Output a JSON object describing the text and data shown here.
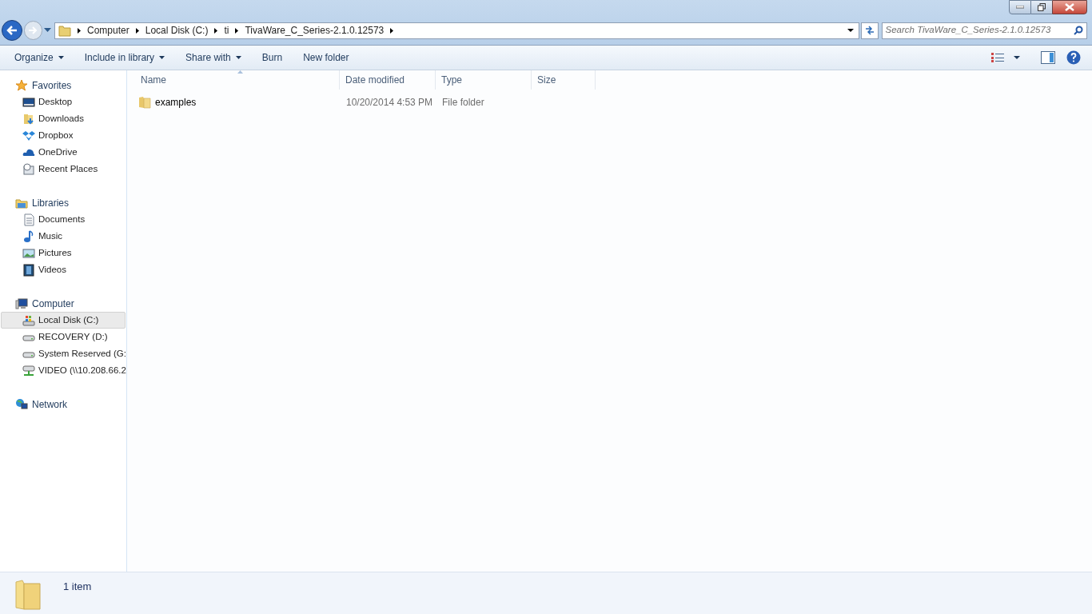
{
  "address_bar": {
    "crumbs": [
      "Computer",
      "Local Disk (C:)",
      "ti",
      "TivaWare_C_Series-2.1.0.12573"
    ]
  },
  "search": {
    "placeholder": "Search TivaWare_C_Series-2.1.0.12573"
  },
  "toolbar": [
    {
      "label": "Organize",
      "has_menu": true
    },
    {
      "label": "Include in library",
      "has_menu": true
    },
    {
      "label": "Share with",
      "has_menu": true
    },
    {
      "label": "Burn",
      "has_menu": false
    },
    {
      "label": "New folder",
      "has_menu": false
    }
  ],
  "sidebar": {
    "groups": [
      {
        "label": "Favorites",
        "kind": "star",
        "items": [
          {
            "label": "Desktop",
            "kind": "desktop",
            "selected": false
          },
          {
            "label": "Downloads",
            "kind": "downloads",
            "selected": false
          },
          {
            "label": "Dropbox",
            "kind": "dropbox",
            "selected": false
          },
          {
            "label": "OneDrive",
            "kind": "cloud",
            "selected": false
          },
          {
            "label": "Recent Places",
            "kind": "recent",
            "selected": false
          }
        ]
      },
      {
        "label": "Libraries",
        "kind": "library",
        "items": [
          {
            "label": "Documents",
            "kind": "document",
            "selected": false
          },
          {
            "label": "Music",
            "kind": "music",
            "selected": false
          },
          {
            "label": "Pictures",
            "kind": "picture",
            "selected": false
          },
          {
            "label": "Videos",
            "kind": "video",
            "selected": false
          }
        ]
      },
      {
        "label": "Computer",
        "kind": "computer",
        "items": [
          {
            "label": "Local Disk (C:)",
            "kind": "sysdrive",
            "selected": true
          },
          {
            "label": "RECOVERY (D:)",
            "kind": "drive",
            "selected": false
          },
          {
            "label": "System Reserved (G:",
            "kind": "drive",
            "selected": false
          },
          {
            "label": "VIDEO (\\\\10.208.66.2",
            "kind": "netdrive",
            "selected": false
          }
        ]
      },
      {
        "label": "Network",
        "kind": "network"
      }
    ]
  },
  "table": {
    "columns": [
      {
        "label": "Name",
        "sorted": true
      },
      {
        "label": "Date modified",
        "sorted": false
      },
      {
        "label": "Type",
        "sorted": false
      },
      {
        "label": "Size",
        "sorted": false
      }
    ],
    "rows": [
      {
        "name": "examples",
        "date_modified": "10/20/2014 4:53 PM",
        "type": "File folder",
        "selected": false
      }
    ]
  },
  "status_bar": {
    "count": "1 item"
  }
}
